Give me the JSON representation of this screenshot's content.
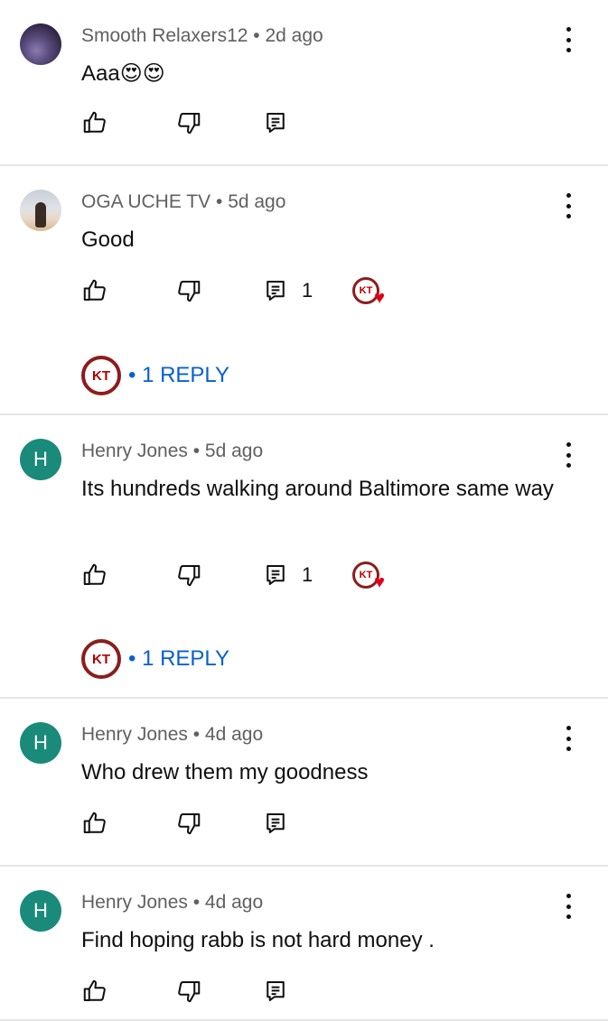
{
  "comments": [
    {
      "avatar": "",
      "avatar_type": "image-purple",
      "author": "Smooth Relaxers12",
      "time": "2d ago",
      "text": "Aaa😍😍",
      "reply_count": "",
      "heart": false,
      "replies_label": ""
    },
    {
      "avatar": "",
      "avatar_type": "image-person",
      "author": "OGA UCHE TV",
      "time": "5d ago",
      "text": "Good",
      "reply_count": "1",
      "heart": true,
      "heart_badge": "KT",
      "replies_avatar": "KT",
      "replies_label": "• 1 REPLY"
    },
    {
      "avatar": "H",
      "author": "Henry Jones",
      "time": "5d ago",
      "text": "Its hundreds walking around Baltimore same way",
      "reply_count": "1",
      "heart": true,
      "heart_badge": "KT",
      "replies_avatar": "KT",
      "replies_label": "• 1 REPLY"
    },
    {
      "avatar": "H",
      "author": "Henry Jones",
      "time": "4d ago",
      "text": "Who drew them my goodness",
      "reply_count": "",
      "heart": false,
      "replies_label": ""
    },
    {
      "avatar": "H",
      "author": "Henry Jones",
      "time": "4d ago",
      "text": "Find hoping rabb is not hard money .",
      "reply_count": "",
      "heart": false,
      "replies_label": ""
    }
  ],
  "separator": " • ",
  "icons": {
    "like": "thumbs-up-icon",
    "dislike": "thumbs-down-icon",
    "reply": "reply-icon",
    "more": "more-vertical-icon",
    "heart": "creator-heart-icon"
  },
  "colors": {
    "link": "#065fd4",
    "avatar_letter_bg": "#1a8a7a",
    "heart": "#e0001b",
    "badge_ring": "#8c1d1d"
  }
}
